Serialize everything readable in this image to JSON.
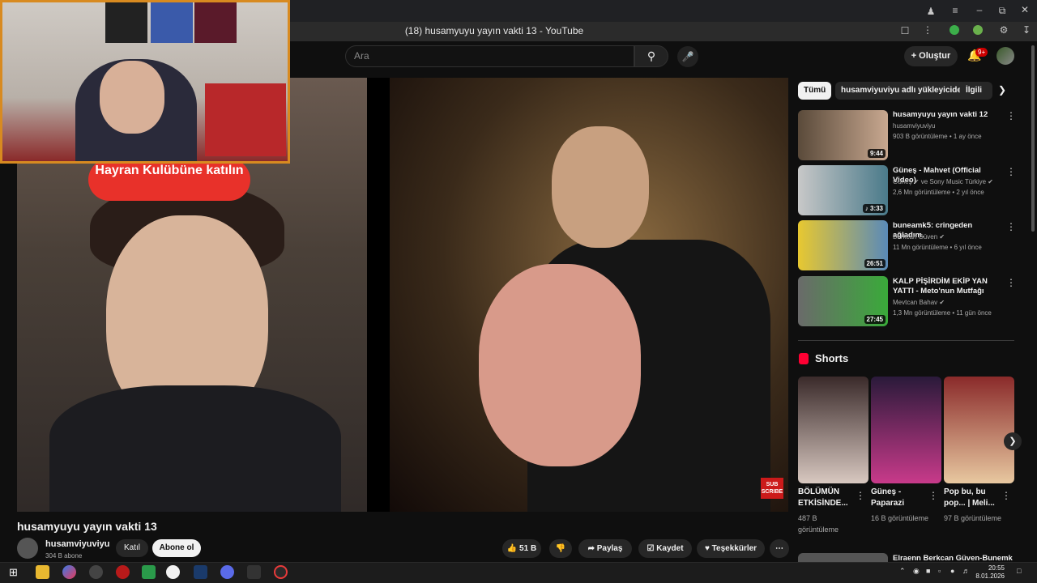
{
  "browser": {
    "tab_title": "(18) husamyuyu yayın vakti 13 - YouTube"
  },
  "header": {
    "search_placeholder": "Ara",
    "create_label": "Oluştur",
    "notification_count": "9+"
  },
  "video": {
    "overlay_banner": "Hayran Kulübüne katılın",
    "sub_badge": "SUB SCRIBE",
    "title": "husamyuyu yayın vakti 13",
    "channel_name": "husamviyuviyu",
    "subscribers": "304 B abone",
    "join_label": "Katıl",
    "subscribe_label": "Abone ol",
    "likes": "51 B",
    "share_label": "Paylaş",
    "save_label": "Kaydet",
    "thanks_label": "Teşekkürler"
  },
  "sidebar": {
    "chips": [
      "Tümü",
      "husamviyuviyu adlı yükleyiciden",
      "İlgili"
    ],
    "recommendations": [
      {
        "title": "husamyuyu yayın vakti 12",
        "channel": "husamviyuviyu",
        "meta": "903 B görüntüleme • 1 ay önce",
        "duration": "9:44"
      },
      {
        "title": "Güneş - Mahvet (Official Video)",
        "channel": "Güneş ✔ ve Sony Music Türkiye ✔",
        "meta": "2,6 Mn görüntüleme • 2 yıl önce",
        "duration": "♪ 3:33"
      },
      {
        "title": "buneamk5: cringeden ağladım.",
        "channel": "Berkcan Güven ✔",
        "meta": "11 Mn görüntüleme • 6 yıl önce",
        "duration": "26:51"
      },
      {
        "title": "KALP PİŞİRDİM EKİP YAN YATTI - Meto'nun Mutfağı",
        "channel": "Mevtcan Bahav ✔",
        "meta": "1,3 Mn görüntüleme • 11 gün önce",
        "duration": "27:45"
      }
    ],
    "shorts_heading": "Shorts",
    "shorts": [
      {
        "title": "BÖLÜMÜN ETKİSİNDE...",
        "views": "487 B görüntüleme"
      },
      {
        "title": "Güneş - Paparazi",
        "views": "16 B görüntüleme"
      },
      {
        "title": "Pop bu, bu pop... | Meli...",
        "views": "97 B görüntüleme"
      }
    ],
    "next_rec_title": "Elraenn Berkcan Güven-Bunemk"
  },
  "taskbar": {
    "time": "20:55",
    "date": "8.01.2026"
  },
  "colors": {
    "background": "#0f0f0f",
    "accent_red": "#ff0033",
    "webcam_border": "#d88a20"
  }
}
